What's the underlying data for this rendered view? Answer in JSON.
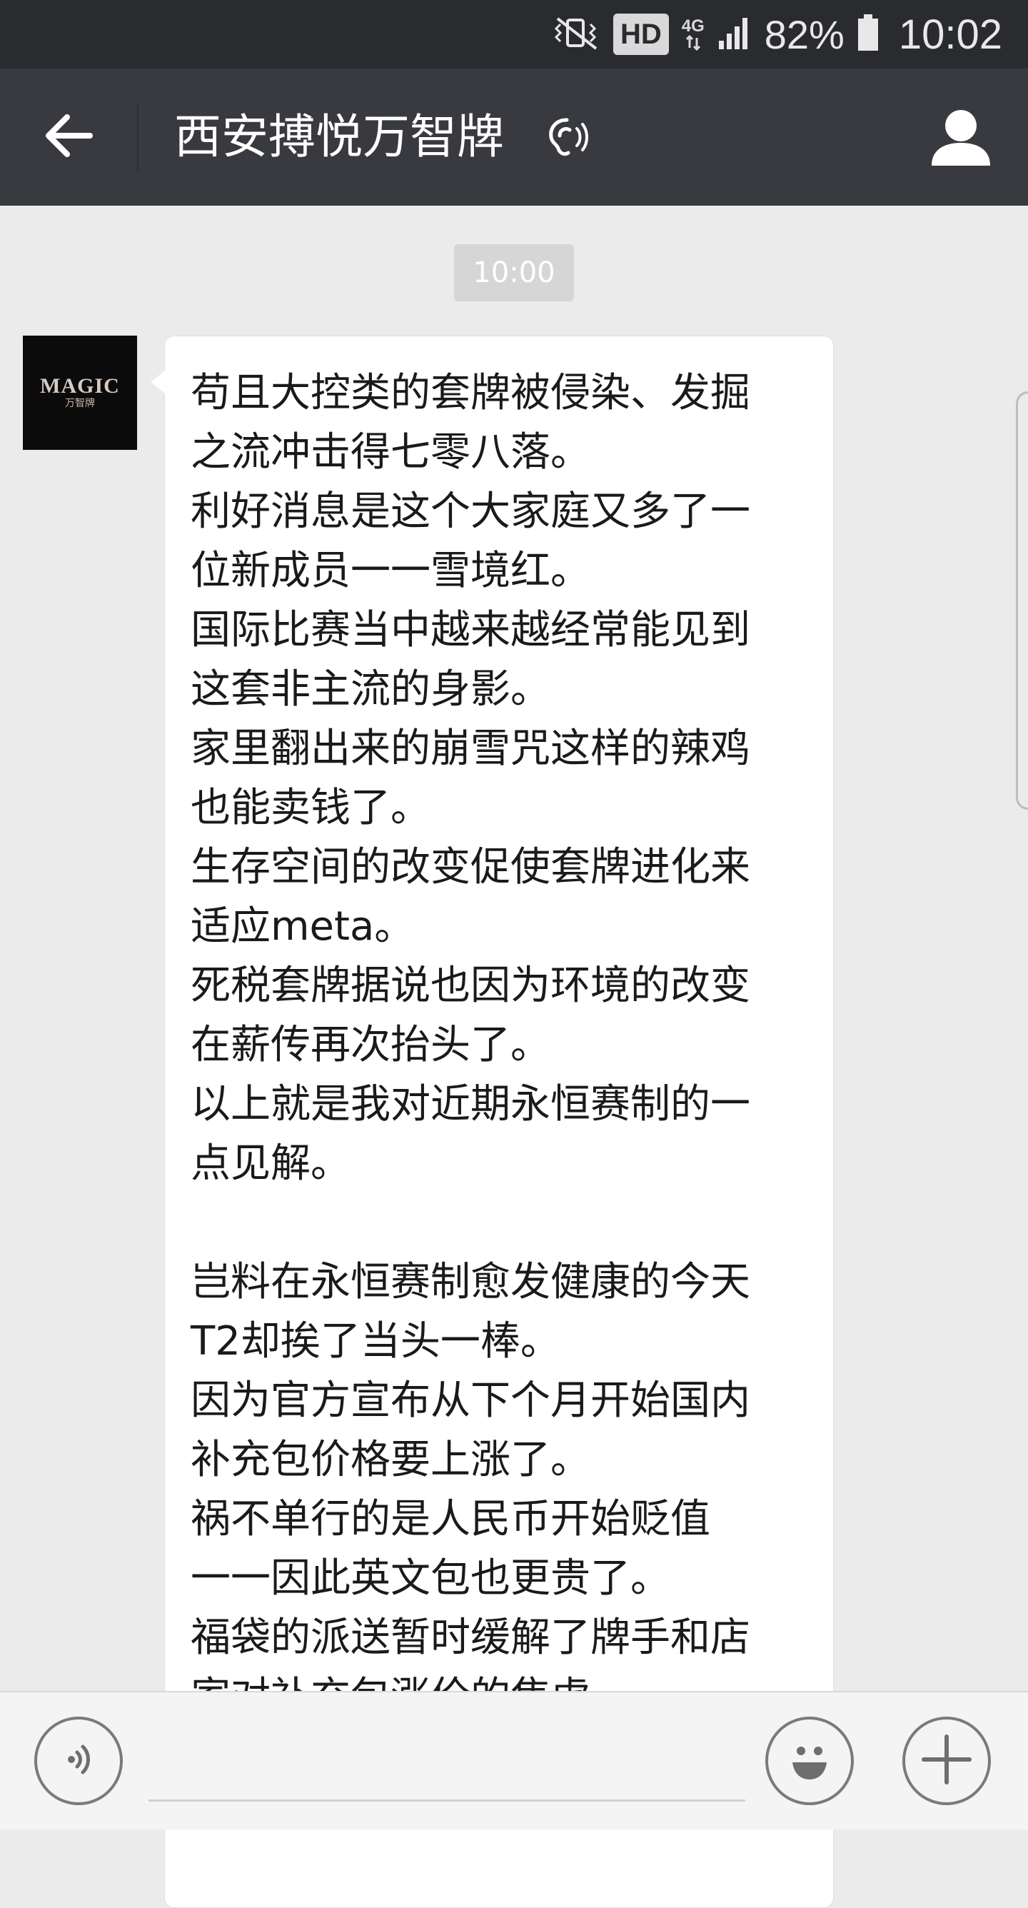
{
  "status_bar": {
    "icons": [
      "vibrate-mute-icon",
      "hd-badge",
      "network-4g-icon",
      "signal-icon",
      "battery-icon"
    ],
    "hd_label": "HD",
    "network_label": "4G",
    "battery_percent": "82%",
    "time": "10:02"
  },
  "header": {
    "back_icon": "back-arrow-icon",
    "title": "西安搏悦万智牌",
    "earpiece_icon": "earpiece-mode-icon",
    "profile_icon": "person-icon"
  },
  "chat": {
    "timestamp": "10:00",
    "avatar": {
      "logo_text": "MAGIC",
      "sub_text": "万智牌"
    },
    "message_lines": [
      "苟且大控类的套牌被侵染、发掘",
      "之流冲击得七零八落。",
      "利好消息是这个大家庭又多了一",
      "位新成员一一雪境红。",
      "国际比赛当中越来越经常能见到",
      "这套非主流的身影。",
      "家里翻出来的崩雪咒这样的辣鸡",
      "也能卖钱了。",
      "生存空间的改变促使套牌进化来",
      "适应meta。",
      "死税套牌据说也因为环境的改变",
      "在薪传再次抬头了。",
      "以上就是我对近期永恒赛制的一",
      "点见解。",
      "",
      "岂料在永恒赛制愈发健康的今天",
      "T2却挨了当头一棒。",
      "因为官方宣布从下个月开始国内",
      "补充包价格要上涨了。",
      "祸不单行的是人民币开始贬值",
      "一一因此英文包也更贵了。",
      "福袋的派送暂时缓解了牌手和店",
      "家对补充包涨价的焦虑"
    ]
  },
  "input_bar": {
    "voice_icon": "voice-input-icon",
    "emoji_icon": "emoji-icon",
    "plus_icon": "plus-icon",
    "input_value": "",
    "input_placeholder": ""
  },
  "colors": {
    "status_bar_bg": "#2a2b2f",
    "title_bar_bg": "#393a3f",
    "chat_bg": "#ebebeb",
    "bubble_bg": "#ffffff",
    "input_bar_bg": "#f4f4f4"
  }
}
